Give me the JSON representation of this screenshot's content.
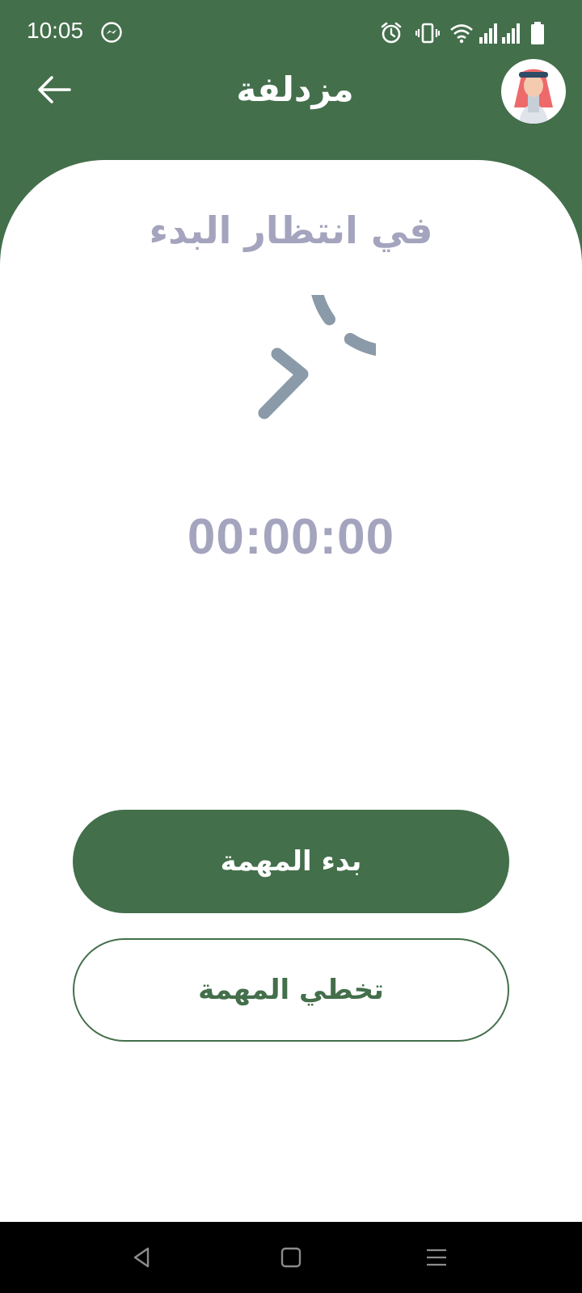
{
  "status_bar": {
    "time": "10:05",
    "icons": [
      "messenger-icon",
      "alarm-icon",
      "vibrate-icon",
      "wifi-icon",
      "signal-icon",
      "signal-icon",
      "battery-icon"
    ]
  },
  "header": {
    "title": "مزدلفة",
    "back_icon": "arrow-left-icon",
    "avatar_icon": "pilgrim-avatar-icon",
    "background_color": "#436f4b"
  },
  "task": {
    "status_text": "في انتظار البدء",
    "timer": "00:00:00",
    "ring_icon": "play-chevron-icon",
    "muted_color": "#a4a4be"
  },
  "actions": {
    "start_label": "بدء المهمة",
    "skip_label": "تخطي المهمة",
    "primary_color": "#436f4b"
  },
  "nav_bar": {
    "icons": [
      "back-triangle-icon",
      "home-square-icon",
      "menu-lines-icon"
    ]
  }
}
